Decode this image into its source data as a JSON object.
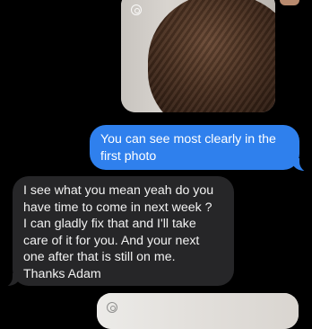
{
  "thread": {
    "messages": [
      {
        "sender": "me",
        "kind": "photo",
        "live_badge_icon": "live-photo-icon"
      },
      {
        "sender": "me",
        "kind": "text",
        "text": "You can see most clearly in the\nfirst photo"
      },
      {
        "sender": "them",
        "kind": "text",
        "text": "I see what you mean yeah do you\nhave time to come in next week ?\nI can gladly fix that and I'll take\ncare of it for you. And your next\none after that is still on me.\nThanks Adam"
      },
      {
        "sender": "me",
        "kind": "photo",
        "live_badge_icon": "live-photo-icon"
      }
    ]
  },
  "colors": {
    "background": "#000000",
    "sent_bubble": "#2f80ed",
    "received_bubble": "#262628",
    "text": "#ffffff"
  }
}
